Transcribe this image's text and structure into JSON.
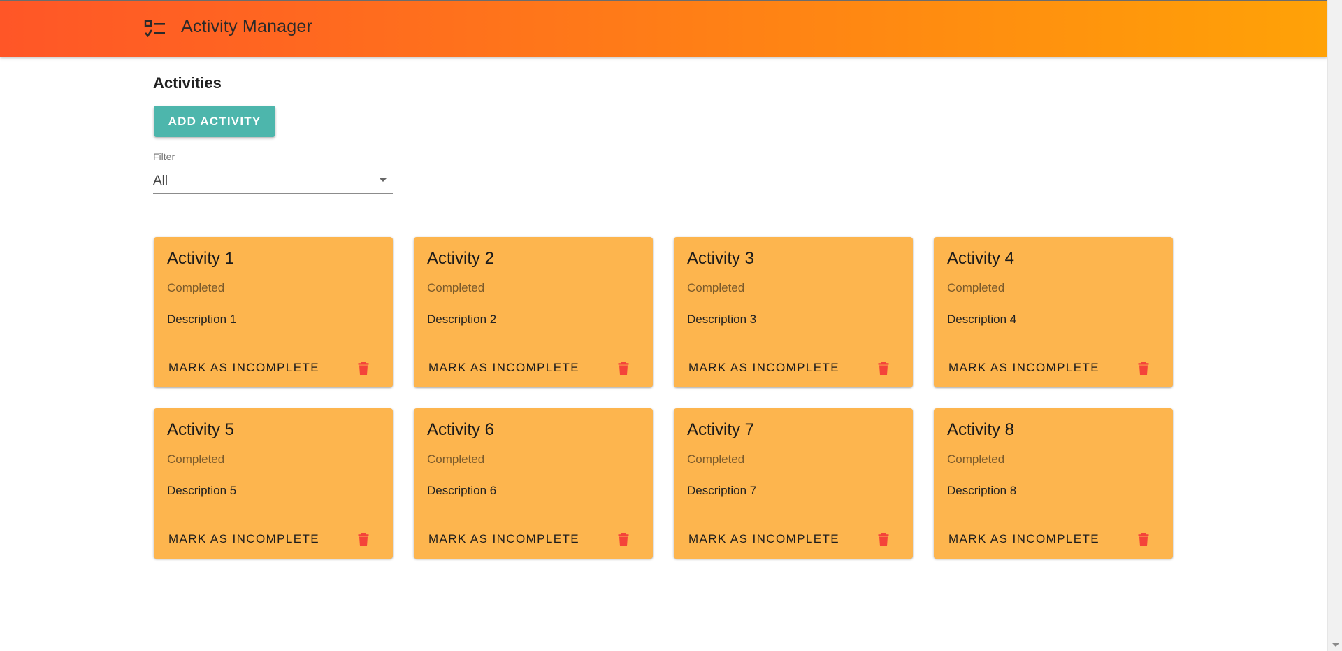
{
  "app": {
    "title": "Activity Manager",
    "icon": "checklist-icon"
  },
  "main": {
    "section_title": "Activities",
    "add_button_label": "ADD ACTIVITY",
    "filter": {
      "label": "Filter",
      "selected": "All"
    }
  },
  "colors": {
    "appbar_gradient": [
      "#ff5627",
      "#ffa207"
    ],
    "add_button": "#4db6ac",
    "card_background": "#fdb54e",
    "delete_icon": "#f4433a"
  },
  "activities": [
    {
      "title": "Activity 1",
      "status": "Completed",
      "description": "Description 1",
      "action_label": "MARK AS INCOMPLETE",
      "delete_icon": "trash-icon"
    },
    {
      "title": "Activity 2",
      "status": "Completed",
      "description": "Description 2",
      "action_label": "MARK AS INCOMPLETE",
      "delete_icon": "trash-icon"
    },
    {
      "title": "Activity 3",
      "status": "Completed",
      "description": "Description 3",
      "action_label": "MARK AS INCOMPLETE",
      "delete_icon": "trash-icon"
    },
    {
      "title": "Activity 4",
      "status": "Completed",
      "description": "Description 4",
      "action_label": "MARK AS INCOMPLETE",
      "delete_icon": "trash-icon"
    },
    {
      "title": "Activity 5",
      "status": "Completed",
      "description": "Description 5",
      "action_label": "MARK AS INCOMPLETE",
      "delete_icon": "trash-icon"
    },
    {
      "title": "Activity 6",
      "status": "Completed",
      "description": "Description 6",
      "action_label": "MARK AS INCOMPLETE",
      "delete_icon": "trash-icon"
    },
    {
      "title": "Activity 7",
      "status": "Completed",
      "description": "Description 7",
      "action_label": "MARK AS INCOMPLETE",
      "delete_icon": "trash-icon"
    },
    {
      "title": "Activity 8",
      "status": "Completed",
      "description": "Description 8",
      "action_label": "MARK AS INCOMPLETE",
      "delete_icon": "trash-icon"
    }
  ]
}
